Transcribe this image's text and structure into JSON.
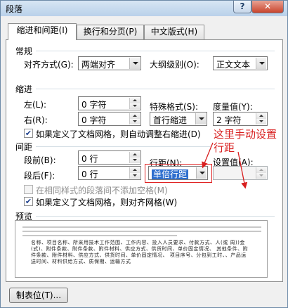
{
  "window": {
    "title": "段落",
    "help_label": "?",
    "close_label": "✕"
  },
  "tabs": [
    {
      "label": "缩进和间距(I)"
    },
    {
      "label": "换行和分页(P)"
    },
    {
      "label": "中文版式(H)"
    }
  ],
  "general": {
    "section": "常规",
    "alignment_label": "对齐方式(G):",
    "alignment_value": "两端对齐",
    "outline_label": "大纲级别(O):",
    "outline_value": "正文文本"
  },
  "indent": {
    "section": "缩进",
    "left_label": "左(L):",
    "left_value": "0 字符",
    "right_label": "右(R):",
    "right_value": "0 字符",
    "special_label": "特殊格式(S):",
    "special_value": "首行缩进",
    "by_label": "度量值(Y):",
    "by_value": "2 字符",
    "grid_check_label": "如果定义了文档网格，则自动调整右缩进(D)"
  },
  "spacing": {
    "section": "间距",
    "before_label": "段前(B):",
    "before_value": "0 行",
    "after_label": "段后(F):",
    "after_value": "0 行",
    "line_label": "行距(N):",
    "line_value": "单倍行距",
    "at_label": "设置值(A):",
    "at_value": "",
    "no_space_label": "在相同样式的段落间不添加空格(M)",
    "snap_grid_label": "如果定义了文档网格，则对齐网格(W)"
  },
  "preview": {
    "section": "预览",
    "sample_text": "名称、项目名称、所采用技术工作范围、工作内容、投入人员要求、付款方式、人(或 周))金(式)、附件条款、附件条款、附件材料、供应方式、供货时间、单价固定情况、 其他条件、附件条款、附件材料、供应方式、供货时间、单价固定情况、 项目序号、分包到工时、、产品运送时间、材料供给方式、质保期、运输方式"
  },
  "footer": {
    "tabs_button": "制表位(T)..."
  },
  "annotation": {
    "text_line1": "这里手动设置",
    "text_line2": "行距"
  },
  "colors": {
    "annotation": "#d81e1e",
    "selection": "#2f6fce"
  }
}
